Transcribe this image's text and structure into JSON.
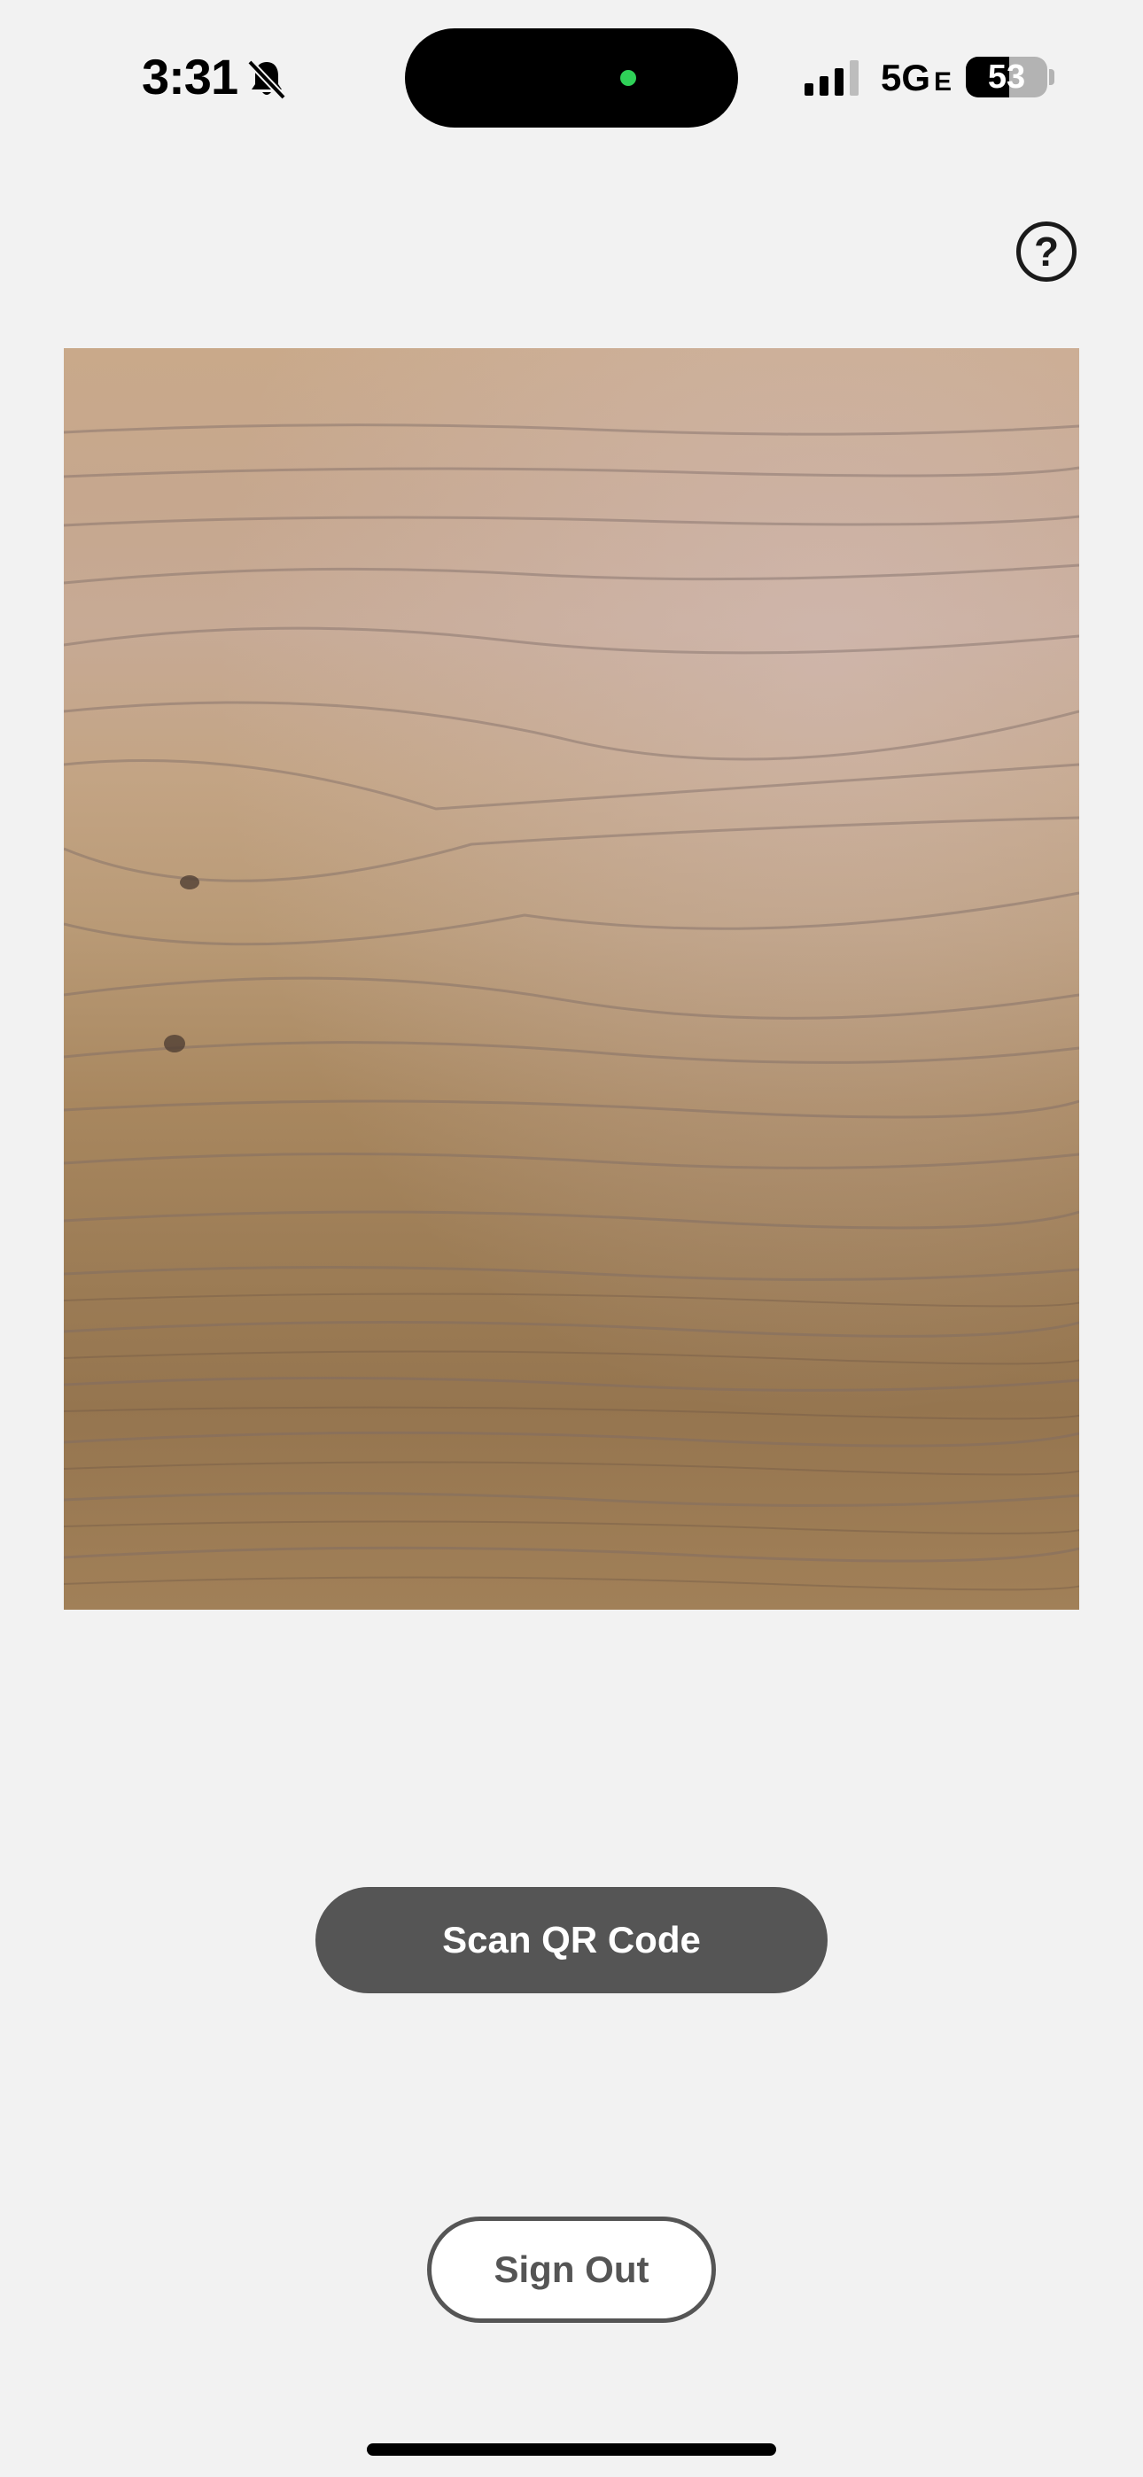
{
  "status_bar": {
    "time": "3:31",
    "network": "5G",
    "network_suffix": "E",
    "battery_level": "53",
    "battery_fraction": 0.53,
    "silent_icon": "bell-slash-icon",
    "signal_icon": "cellular-signal-icon"
  },
  "help": {
    "glyph": "?",
    "icon": "question-circle-icon"
  },
  "actions": {
    "scan_label": "Scan QR Code",
    "sign_out_label": "Sign Out"
  },
  "colors": {
    "background": "#f2f2f2",
    "primary_button": "#555555",
    "status_dot": "#2fd158"
  }
}
